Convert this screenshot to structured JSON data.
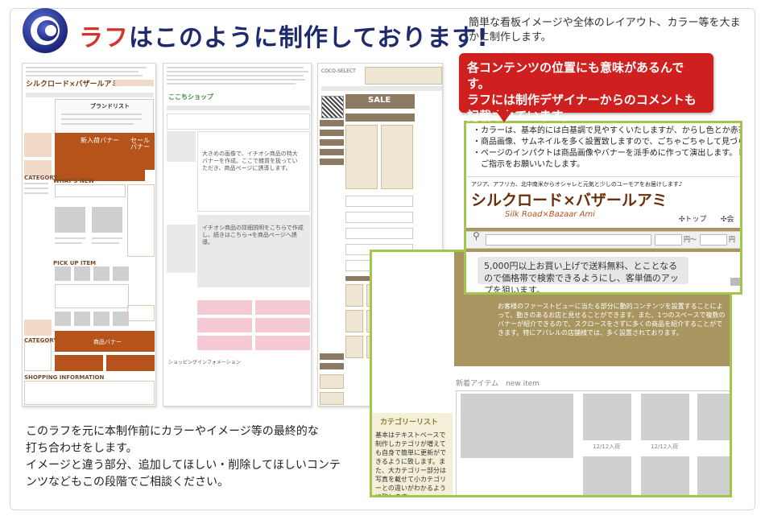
{
  "header": {
    "title_accent": "ラフ",
    "title_rest": "はこのように制作しております!",
    "intro": "簡単な看板イメージや全体のレイアウト、カラー等を大まかに制作します。"
  },
  "callout": {
    "line1": "各コンテンツの位置にも意味があるんです。",
    "line2": "ラフには制作デザイナーからのコメントも",
    "line3": "記載されています。"
  },
  "zoom": {
    "bullets": [
      "・カラーは、基本的には白基調で見やすくいたしますが、からし色とか赤茶色",
      "・商品画像、サムネイルを多く設置致しますので、ごちゃごちゃして見づらくな",
      "・ページのインパクトは商品画像やバナーを派手めに作って演出します。トップ",
      "　ご指示をお願いいたします。"
    ],
    "tagline": "アジア、アフリカ、北中南米からオシャレと元気と少しのユーモアをお届けします♪",
    "logo_text": "シルクロード×バザールアミ",
    "logo_sub": "Silk Road×Bazaar Ami",
    "nav_top": "トップ",
    "nav_more": "会",
    "yen1": "円〜",
    "yen2": "円",
    "note": "5,000円以上お買い上げで送料無料、とことなるので価格帯で検索できるようにし、客単価のアップを狙います。"
  },
  "detail": {
    "banner_text": "お客様のファーストビューに当たる部分に動的コンテンツを設置することによって、動きのあるお店と見せることができます。また、1つのスペースで複数のバナーが紹介できるので、スクロースをさずに多くの商品を紹介することができます。特にアパレルの店舗様では、多く設置されております。",
    "new_item": "新着アイテム　new item",
    "caption1": "12/12入荷",
    "caption2": "12/12入荷",
    "category_title": "カテゴリーリスト",
    "category_text": "基本はテキストベースで制作しカテゴリが増えても自身で簡単に更新ができるように致します。また、大カテゴリー部分は写真を載せて小カテゴリーとの違いがわかるように致します。"
  },
  "thumb1": {
    "brand_list": "ブランドリスト",
    "new_banner": "新入荷バナー",
    "sale_banner": "セール\nバナー",
    "pickup": "PICK UP ITEM",
    "product_banner": "商品バナー",
    "shop_info": "SHOPPING INFORMATION",
    "category": "CATEGORY",
    "whats_new": "WHAT'S NEW"
  },
  "thumb2": {
    "shop_name": "ここちショップ",
    "banner_text": "大きめの画像で、イチオシ商品の特大バナーを作成。ここで雑貨を扱っていただき、商品ページに誘導します。",
    "banner_text2": "イチオシ商品の詳細説明をこちらで作成し、続きはこちら→を商品ページへ誘導。",
    "footer": "ショッピングインフォメーション"
  },
  "thumb3": {
    "sale": "SALE",
    "shop_label": "COCO-SELECT"
  },
  "footer": {
    "line1": "このラフを元に本制作前にカラーやイメージ等の最終的な",
    "line2": "打ち合わせをします。",
    "line3": "イメージと違う部分、追加してほしい・削除してほしいコンテ",
    "line4": "ンツなどもこの段階でご相談ください。"
  },
  "colors": {
    "accent_red": "#d0362c",
    "title_navy": "#1e2a6e",
    "callout_red": "#cf1f1f",
    "frame_green": "#a1c64a",
    "rough_orange": "#b5531a",
    "banner_brown": "#a9955f"
  }
}
